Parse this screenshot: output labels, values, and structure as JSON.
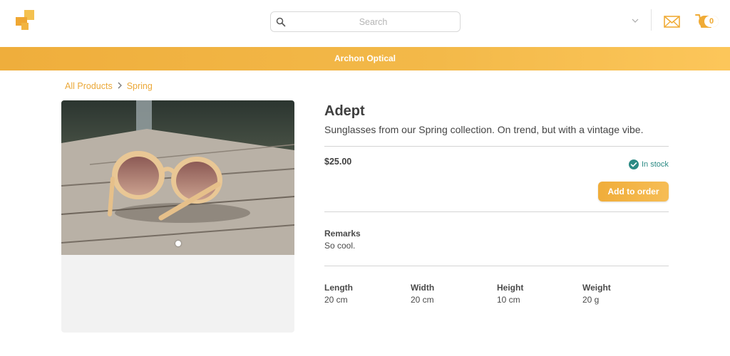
{
  "header": {
    "logo_icon": "brand-logo-icon",
    "search": {
      "placeholder": "Search",
      "icon": "search-icon"
    },
    "account_dropdown_icon": "chevron-down-icon",
    "messages_icon": "envelope-icon",
    "cart": {
      "icon": "shopping-cart-icon",
      "count": "0"
    }
  },
  "banner": {
    "text": "Archon Optical"
  },
  "breadcrumb": {
    "items": [
      "All Products",
      "Spring"
    ],
    "separator_icon": "chevron-right-icon"
  },
  "gallery": {
    "image": "sunglasses-on-dock-photo",
    "active_slide": 1,
    "slides": 1
  },
  "product": {
    "name": "Adept",
    "description": "Sunglasses from our Spring collection. On trend, but with a vintage vibe.",
    "price": "$25.00",
    "stock_status": "In stock",
    "add_button_label": "Add to order"
  },
  "remarks": {
    "label": "Remarks",
    "value": "So cool."
  },
  "specs": [
    {
      "label": "Length",
      "value": "20 cm"
    },
    {
      "label": "Width",
      "value": "20 cm"
    },
    {
      "label": "Height",
      "value": "10 cm"
    },
    {
      "label": "Weight",
      "value": "20 g"
    }
  ],
  "colors": {
    "accent": "#f0ab36",
    "stock": "#2b8a84",
    "text": "#444444"
  }
}
